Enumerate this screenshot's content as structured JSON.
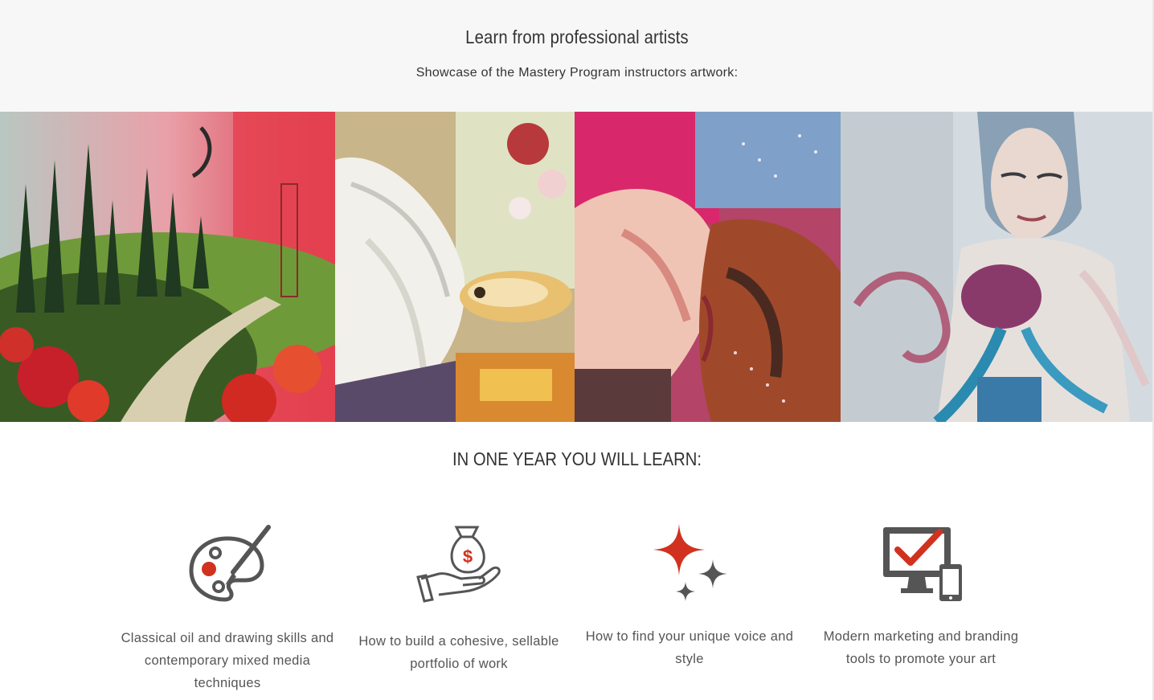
{
  "header": {
    "title": "Learn from professional artists",
    "subtitle": "Showcase of the Mastery Program instructors artwork:"
  },
  "gallery": {
    "items": [
      {
        "name": "landscape-painting",
        "palette": [
          "#c9403a",
          "#2f4a2c",
          "#e9a0a8",
          "#7aa04a"
        ]
      },
      {
        "name": "figure-fish-painting",
        "palette": [
          "#f2f0e8",
          "#d98a3a",
          "#e0e6c8",
          "#b33b3b"
        ]
      },
      {
        "name": "kissing-couple-painting",
        "palette": [
          "#d8286b",
          "#9a3a22",
          "#f0c0b0",
          "#4a3a40"
        ]
      },
      {
        "name": "woman-octopus-painting",
        "palette": [
          "#c8d4df",
          "#8a3a6a",
          "#2a8ab0",
          "#e0d8d0"
        ]
      }
    ]
  },
  "learn": {
    "title": "IN ONE YEAR YOU WILL LEARN:",
    "features": [
      {
        "icon": "palette-brush-icon",
        "text": "Classical oil and drawing skills and contemporary mixed media techniques"
      },
      {
        "icon": "money-bag-hand-icon",
        "text": "How to build a cohesive, sellable portfolio of work"
      },
      {
        "icon": "sparkles-icon",
        "text": "How to find your unique voice and style"
      },
      {
        "icon": "monitor-phone-check-icon",
        "text": "Modern marketing and branding tools to promote your art"
      }
    ]
  },
  "colors": {
    "accent": "#d0321f",
    "icon_gray": "#555555",
    "band": "#f7f7f7"
  }
}
